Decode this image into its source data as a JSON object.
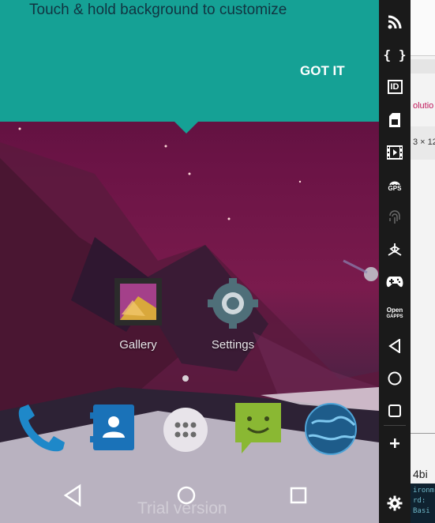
{
  "tooltip": {
    "message": "Touch & hold background to customize",
    "action": "GOT IT"
  },
  "apps": [
    {
      "label": "Gallery"
    },
    {
      "label": "Settings"
    }
  ],
  "dock": [
    "phone-icon",
    "contacts-icon",
    "app-drawer-icon",
    "messaging-icon",
    "browser-icon"
  ],
  "watermark": "Trial version",
  "sidebar": {
    "buttons": [
      "rss-icon",
      "braces-icon",
      "id-icon",
      "sim-icon",
      "film-icon",
      "gps-icon",
      "fingerprint-icon",
      "accelerometer-icon",
      "gamepad-icon",
      "open-gapps-icon",
      "back-icon",
      "home-icon",
      "recents-icon",
      "plus-icon",
      "gear-icon"
    ],
    "gps_label": "GPS",
    "id_label": "ID",
    "open_gapps_label_1": "Open",
    "open_gapps_label_2": "GAPPS"
  },
  "right_panel": {
    "text_1": "olutio",
    "text_2": "3 × 12",
    "text_3": "4bi",
    "text_4": "ironm",
    "text_5": "rd:",
    "text_6": "Basi"
  },
  "colors": {
    "tooltip": "#15a195",
    "accent_pink": "#c2185b"
  }
}
